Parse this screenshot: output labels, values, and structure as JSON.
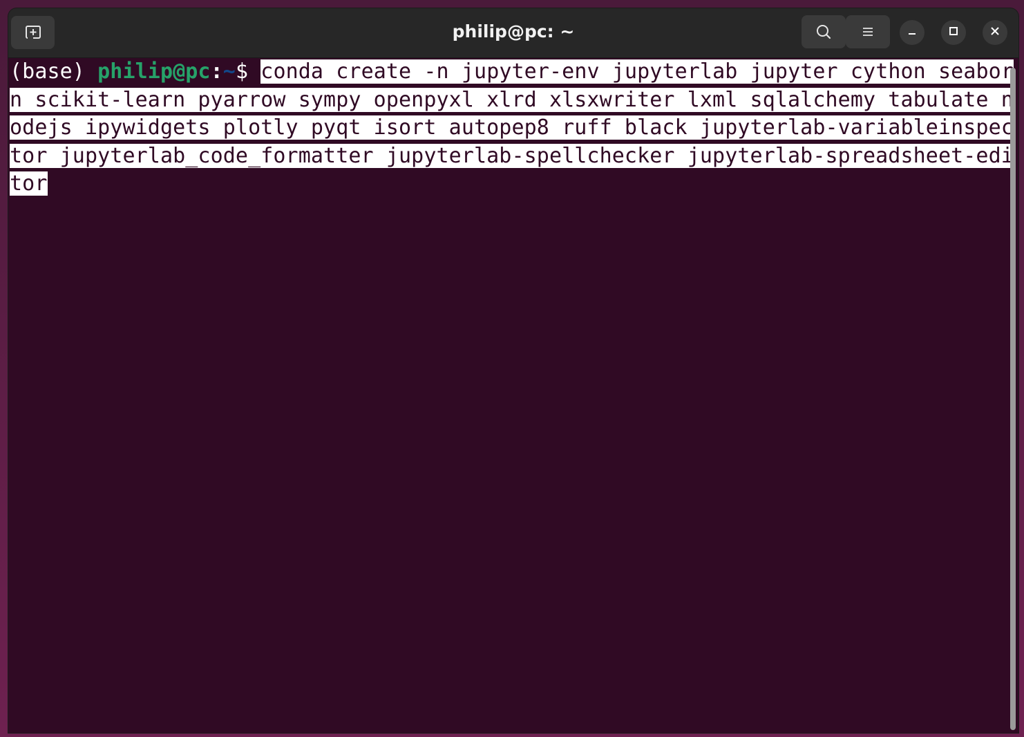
{
  "window": {
    "title": "philip@pc: ~"
  },
  "titlebar": {
    "new_tab_icon": "new-tab-icon",
    "search_icon": "search-icon",
    "menu_icon": "hamburger-menu-icon",
    "minimize_icon": "minimize-icon",
    "maximize_icon": "maximize-icon",
    "close_icon": "close-icon"
  },
  "terminal": {
    "prompt": {
      "env": "(base) ",
      "user_host": "philip@pc",
      "colon": ":",
      "path": "~",
      "dollar": "$ "
    },
    "command_lines": [
      "conda create -n jupyter-env jupyterlab jupyter cython seabor",
      "n scikit-learn pyarrow sympy openpyxl xlrd xlsxwriter lxml sqlalchemy tabulate n",
      "odejs ipywidgets plotly pyqt isort autopep8 ruff black jupyterlab-variableinspec",
      "tor jupyterlab_code_formatter jupyterlab-spellchecker jupyterlab-spreadsheet-edi",
      "tor"
    ],
    "selection_highlighted": true
  },
  "colors": {
    "terminal_bg": "#300a24",
    "titlebar_bg": "#272727",
    "prompt_user": "#26a269",
    "prompt_path": "#12488b",
    "selection_bg": "#ffffff"
  }
}
